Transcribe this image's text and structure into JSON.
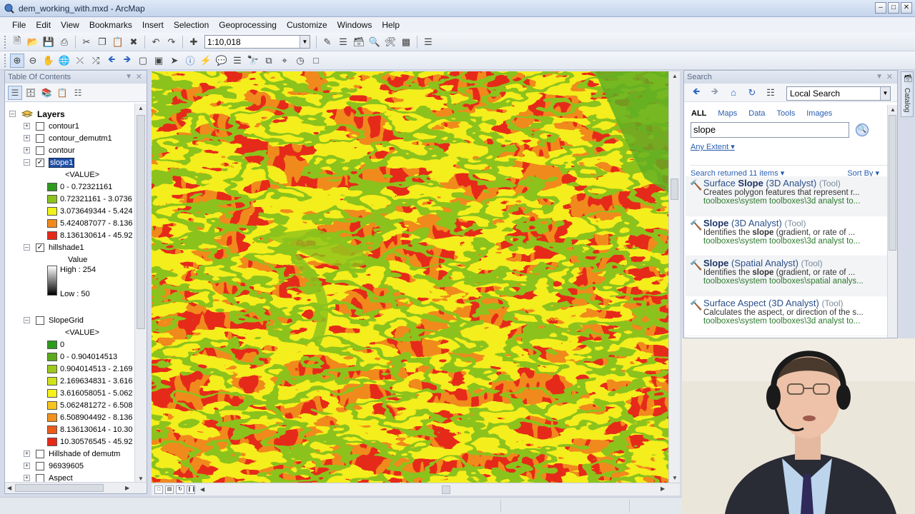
{
  "window": {
    "title": "dem_working_with.mxd - ArcMap",
    "app_icon": "arcmap-globe-icon"
  },
  "menu": [
    "File",
    "Edit",
    "View",
    "Bookmarks",
    "Insert",
    "Selection",
    "Geoprocessing",
    "Customize",
    "Windows",
    "Help"
  ],
  "standard_toolbar": {
    "scale": "1:10,018"
  },
  "toc": {
    "title": "Table Of Contents",
    "root": "Layers",
    "layers": [
      {
        "name": "contour1",
        "checked": false
      },
      {
        "name": "contour_demutm1",
        "checked": false
      },
      {
        "name": "contour",
        "checked": false
      },
      {
        "name": "slope1",
        "checked": true,
        "selected": true,
        "legend_heading": "<VALUE>",
        "classes": [
          {
            "label": "0 - 0.72321161",
            "color": "#2e9a1e"
          },
          {
            "label": "0.72321161 - 3.0736",
            "color": "#8cc21c"
          },
          {
            "label": "3.073649344 - 5.424",
            "color": "#f0f21a"
          },
          {
            "label": "5.424087077 - 8.136",
            "color": "#f08a1c"
          },
          {
            "label": "8.136130614 - 45.92",
            "color": "#e62a1a"
          }
        ]
      },
      {
        "name": "hillshade1",
        "checked": true,
        "legend_heading": "Value",
        "high": "High : 254",
        "low": "Low : 50"
      },
      {
        "name": "SlopeGrid",
        "checked": false,
        "legend_heading": "<VALUE>",
        "classes": [
          {
            "label": "0",
            "color": "#2e9a1e"
          },
          {
            "label": "0 - 0.904014513",
            "color": "#5aaa1c"
          },
          {
            "label": "0.904014513 - 2.169",
            "color": "#9cc81c"
          },
          {
            "label": "2.169634831 - 3.616",
            "color": "#cfe21c"
          },
          {
            "label": "3.616058051 - 5.062",
            "color": "#f6f21a"
          },
          {
            "label": "5.062481272 - 6.508",
            "color": "#f6c41a"
          },
          {
            "label": "6.508904492 - 8.136",
            "color": "#f0921c"
          },
          {
            "label": "8.136130614 - 10.30",
            "color": "#ec5a1a"
          },
          {
            "label": "10.30576545 - 45.92",
            "color": "#e62a1a"
          }
        ]
      },
      {
        "name": "Hillshade of demutm",
        "checked": false
      },
      {
        "name": "96939605",
        "checked": false
      },
      {
        "name": "Aspect",
        "checked": false
      }
    ]
  },
  "search": {
    "title": "Search",
    "scope": "Local Search",
    "tabs": [
      "ALL",
      "Maps",
      "Data",
      "Tools",
      "Images"
    ],
    "query": "slope",
    "extent": "Any Extent",
    "summary": "Search returned 11 items",
    "sort": "Sort By",
    "results": [
      {
        "pre": "Surface ",
        "bold": "Slope",
        "post": " (3D Analyst)",
        "type": "(Tool)",
        "desc_pre": "Creates polygon features that represent r...",
        "desc_bold": "",
        "desc_post": "",
        "path": "toolboxes\\system toolboxes\\3d analyst to..."
      },
      {
        "pre": "",
        "bold": "Slope",
        "post": " (3D Analyst)",
        "type": "(Tool)",
        "desc_pre": "Identifies the ",
        "desc_bold": "slope",
        "desc_post": " (gradient, or rate of ...",
        "path": "toolboxes\\system toolboxes\\3d analyst to..."
      },
      {
        "pre": "",
        "bold": "Slope",
        "post": " (Spatial Analyst)",
        "type": "(Tool)",
        "desc_pre": "Identifies the ",
        "desc_bold": "slope",
        "desc_post": " (gradient, or rate of ...",
        "path": "toolboxes\\system toolboxes\\spatial analys..."
      },
      {
        "pre": "Surface Aspect (3D Analyst)",
        "bold": "",
        "post": "",
        "type": "(Tool)",
        "desc_pre": "Calculates the aspect, or direction of the s...",
        "desc_bold": "",
        "desc_post": "",
        "path": "toolboxes\\system toolboxes\\3d analyst to..."
      }
    ]
  },
  "catalog_tab": "Catalog",
  "map": {
    "palette": [
      "#e62a1a",
      "#f08a1c",
      "#f4ee1a",
      "#8cc21c",
      "#2e9a1e"
    ]
  }
}
